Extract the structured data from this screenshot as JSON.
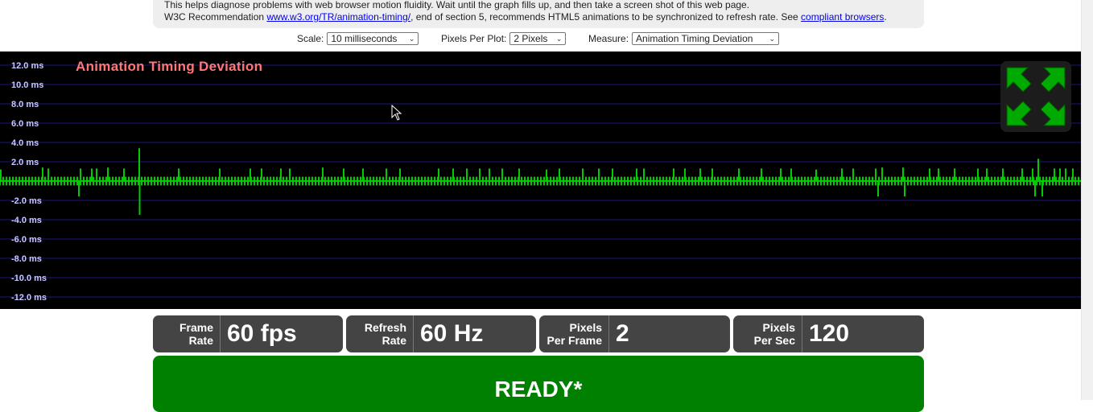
{
  "info": {
    "line1": "This helps diagnose problems with web browser motion fluidity. Wait until the graph fills up, and then take a screen shot of this web page.",
    "line2_prefix": "W3C Recommendation ",
    "line2_link": "www.w3.org/TR/animation-timing/",
    "line2_middle": ", end of section 5, recommends HTML5 animations to be synchronized to refresh rate. See ",
    "line2_link2": "compliant browsers",
    "line2_suffix": "."
  },
  "controls": {
    "scale_label": "Scale:",
    "scale_value": "10 milliseconds",
    "ppp_label": "Pixels Per Plot:",
    "ppp_value": "2 Pixels",
    "measure_label": "Measure:",
    "measure_value": "Animation Timing Deviation"
  },
  "chart_data": {
    "type": "line",
    "title": "Animation Timing Deviation",
    "y_ticks": [
      "12.0 ms",
      "10.0 ms",
      "8.0 ms",
      "6.0 ms",
      "4.0 ms",
      "2.0 ms",
      "-2.0 ms",
      "-4.0 ms",
      "-6.0 ms",
      "-8.0 ms",
      "-10.0 ms",
      "-12.0 ms"
    ],
    "ylim": [
      -13,
      13
    ],
    "grid": true,
    "series": [
      {
        "color": "#00cc00",
        "description_values": [
          0.3,
          0.3,
          0.3,
          0.3,
          0.3,
          0.3,
          0.3,
          0.3,
          0.3,
          0.3,
          1.5,
          0.3,
          0.3,
          0.3,
          0.3,
          0.3,
          0.3,
          0.3,
          0.3,
          0.3,
          0.3,
          0.3,
          0.3,
          0.3,
          0.3,
          0.3,
          0.3,
          0.3,
          0.3,
          0.3,
          1.4,
          0.3,
          0.3,
          0.3,
          0.3,
          0.3,
          0.3,
          0.3,
          0.3,
          0.3,
          0.3,
          0.3,
          0.3,
          0.3,
          0.3,
          0.3,
          0.3,
          0.3,
          0.3,
          0.3,
          0.3,
          0.3,
          0.3,
          0.3,
          0.3,
          0.3,
          0.3,
          0.3,
          0.3,
          0.3,
          0.3,
          0.3,
          0.3,
          0.3,
          0.3,
          0.3,
          0.3,
          0.3,
          0.3,
          0.3,
          0.3,
          0.3,
          0.3,
          0.3,
          0.3,
          0.3,
          0.3,
          0.3,
          0.3,
          0.3,
          0.3,
          0.3,
          0.3,
          0.3,
          0.3,
          0.3,
          0.3,
          0.3,
          0.3,
          0.3,
          0.3,
          0.3,
          0.3,
          0.3,
          0.3,
          0.3,
          0.3,
          1.5,
          0.3,
          0.3
        ],
        "spikes": [
          {
            "x": 1,
            "y": 1.2
          },
          {
            "x": 53,
            "y": 1.4
          },
          {
            "x": 60,
            "y": 1.3
          },
          {
            "x": 98,
            "y": -1.6
          },
          {
            "x": 100,
            "y": 1.3
          },
          {
            "x": 114,
            "y": 1.3
          },
          {
            "x": 120,
            "y": 1.3
          },
          {
            "x": 134,
            "y": 1.4
          },
          {
            "x": 154,
            "y": 1.3
          },
          {
            "x": 173,
            "y": 3.4
          },
          {
            "x": 173.5,
            "y": -3.5
          },
          {
            "x": 222,
            "y": 1.3
          },
          {
            "x": 273,
            "y": 1.3
          },
          {
            "x": 311,
            "y": 1.3
          },
          {
            "x": 325,
            "y": 1.3
          },
          {
            "x": 349,
            "y": 1.3
          },
          {
            "x": 360,
            "y": 1.3
          },
          {
            "x": 401,
            "y": 1.4
          },
          {
            "x": 427,
            "y": 1.3
          },
          {
            "x": 451,
            "y": 1.3
          },
          {
            "x": 480,
            "y": 1.3
          },
          {
            "x": 497,
            "y": 1.3
          },
          {
            "x": 545,
            "y": 1.3
          },
          {
            "x": 563,
            "y": 1.3
          },
          {
            "x": 580,
            "y": 1.3
          },
          {
            "x": 596,
            "y": 1.3
          },
          {
            "x": 608,
            "y": 1.3
          },
          {
            "x": 624,
            "y": 1.3
          },
          {
            "x": 645,
            "y": 1.3
          },
          {
            "x": 679,
            "y": 1.2
          },
          {
            "x": 695,
            "y": 1.3
          },
          {
            "x": 724,
            "y": 1.3
          },
          {
            "x": 744,
            "y": 1.3
          },
          {
            "x": 761,
            "y": 1.3
          },
          {
            "x": 791,
            "y": 1.3
          },
          {
            "x": 800,
            "y": 1.3
          },
          {
            "x": 837,
            "y": 1.3
          },
          {
            "x": 851,
            "y": 1.3
          },
          {
            "x": 870,
            "y": 1.3
          },
          {
            "x": 885,
            "y": 1.3
          },
          {
            "x": 918,
            "y": 1.3
          },
          {
            "x": 946,
            "y": 1.3
          },
          {
            "x": 970,
            "y": 1.3
          },
          {
            "x": 983,
            "y": 1.3
          },
          {
            "x": 1014,
            "y": 1.2
          },
          {
            "x": 1046,
            "y": 1.3
          },
          {
            "x": 1060,
            "y": 1.3
          },
          {
            "x": 1088,
            "y": 1.3
          },
          {
            "x": 1091,
            "y": -1.6
          },
          {
            "x": 1096,
            "y": 1.4
          },
          {
            "x": 1122,
            "y": 1.4
          },
          {
            "x": 1124,
            "y": -1.6
          },
          {
            "x": 1155,
            "y": 1.3
          },
          {
            "x": 1166,
            "y": 1.3
          },
          {
            "x": 1186,
            "y": 1.3
          },
          {
            "x": 1215,
            "y": 1.3
          },
          {
            "x": 1226,
            "y": 1.3
          },
          {
            "x": 1246,
            "y": 1.3
          },
          {
            "x": 1270,
            "y": 1.3
          },
          {
            "x": 1283,
            "y": 1.3
          },
          {
            "x": 1286,
            "y": -1.6
          },
          {
            "x": 1290,
            "y": 2.3
          },
          {
            "x": 1295,
            "y": -1.6
          },
          {
            "x": 1310,
            "y": 1.3
          },
          {
            "x": 1317,
            "y": 1.3
          },
          {
            "x": 1324,
            "y": 1.3
          },
          {
            "x": 1333,
            "y": 1.3
          }
        ]
      }
    ]
  },
  "stats": [
    {
      "label_line1": "Frame",
      "label_line2": "Rate",
      "value": "60 fps"
    },
    {
      "label_line1": "Refresh",
      "label_line2": "Rate",
      "value": "60 Hz"
    },
    {
      "label_line1": "Pixels",
      "label_line2": "Per Frame",
      "value": "2"
    },
    {
      "label_line1": "Pixels",
      "label_line2": "Per Sec",
      "value": "120"
    }
  ],
  "ready": {
    "text": "READY*"
  },
  "colors": {
    "graph_bg": "#000000",
    "trace": "#00cc00",
    "grid": "#1a1a7a",
    "title": "#ff7777",
    "axis_label": "#c8c8ff",
    "stat_bg": "#444444",
    "ready_bg": "#008000",
    "fullscreen_arrows": "#00aa00"
  },
  "icons": {
    "fullscreen": "expand-arrows-icon",
    "cursor": "mouse-pointer-icon"
  }
}
